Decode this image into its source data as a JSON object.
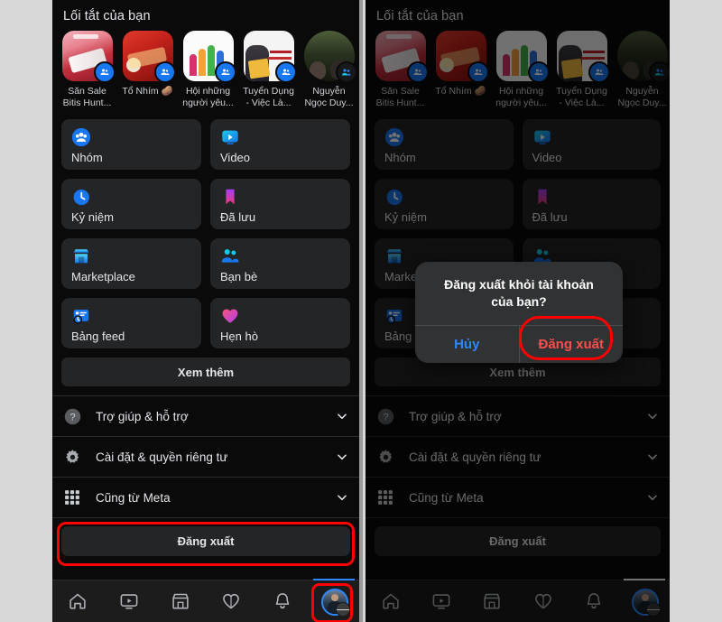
{
  "page": {
    "background_color": "#d7d7d7",
    "panel_background": "#0a0a0a",
    "accent_blue": "#1877f2",
    "highlight_red": "#ff0000",
    "danger_red": "#ff4d4d",
    "link_blue": "#2d88ff",
    "tile_background": "#242526"
  },
  "menu": {
    "shortcuts_title": "Lối tắt của bạn",
    "shortcuts": [
      {
        "label": "Săn Sale Bitis Hunt...",
        "art": "art1",
        "badge": "group-badge-icon",
        "shape": "rounded"
      },
      {
        "label": "Tổ Nhím 🥔",
        "art": "art2",
        "badge": "group-badge-icon",
        "shape": "rounded"
      },
      {
        "label": "Hội những người yêu...",
        "art": "art3",
        "badge": "group-badge-icon",
        "shape": "rounded"
      },
      {
        "label": "Tuyển Dụng - Việc Là...",
        "art": "art4",
        "badge": "group-badge-icon",
        "shape": "rounded"
      },
      {
        "label": "Nguyễn Ngọc Duy...",
        "art": "art5",
        "badge": "friends-badge-icon",
        "shape": "circle"
      }
    ],
    "tiles": [
      {
        "label": "Nhóm",
        "icon": "groups-icon"
      },
      {
        "label": "Video",
        "icon": "video-icon"
      },
      {
        "label": "Kỷ niệm",
        "icon": "memories-clock-icon"
      },
      {
        "label": "Đã lưu",
        "icon": "bookmark-icon"
      },
      {
        "label": "Marketplace",
        "icon": "marketplace-shop-icon"
      },
      {
        "label": "Bạn bè",
        "icon": "friends-icon"
      },
      {
        "label": "Bảng feed",
        "icon": "feeds-icon"
      },
      {
        "label": "Hẹn hò",
        "icon": "dating-heart-icon"
      }
    ],
    "see_more_label": "Xem thêm",
    "accordion_rows": [
      {
        "label": "Trợ giúp & hỗ trợ",
        "icon": "help-question-icon",
        "chevron": "chevron-down-icon"
      },
      {
        "label": "Cài đặt & quyền riêng tư",
        "icon": "settings-gear-icon",
        "chevron": "chevron-down-icon"
      },
      {
        "label": "Cũng từ Meta",
        "icon": "meta-apps-grid-icon",
        "chevron": "chevron-down-icon"
      }
    ],
    "logout_label": "Đăng xuất"
  },
  "bottom_nav": [
    {
      "name": "home",
      "icon": "home-icon"
    },
    {
      "name": "video",
      "icon": "video-play-icon"
    },
    {
      "name": "marketplace",
      "icon": "marketplace-icon"
    },
    {
      "name": "dating",
      "icon": "heart-icon"
    },
    {
      "name": "notifications",
      "icon": "bell-icon"
    },
    {
      "name": "profile-menu",
      "icon": "avatar-menu-icon"
    }
  ],
  "dialog": {
    "title": "Đăng xuất khỏi tài khoản của bạn?",
    "cancel_label": "Hủy",
    "confirm_label": "Đăng xuất"
  }
}
